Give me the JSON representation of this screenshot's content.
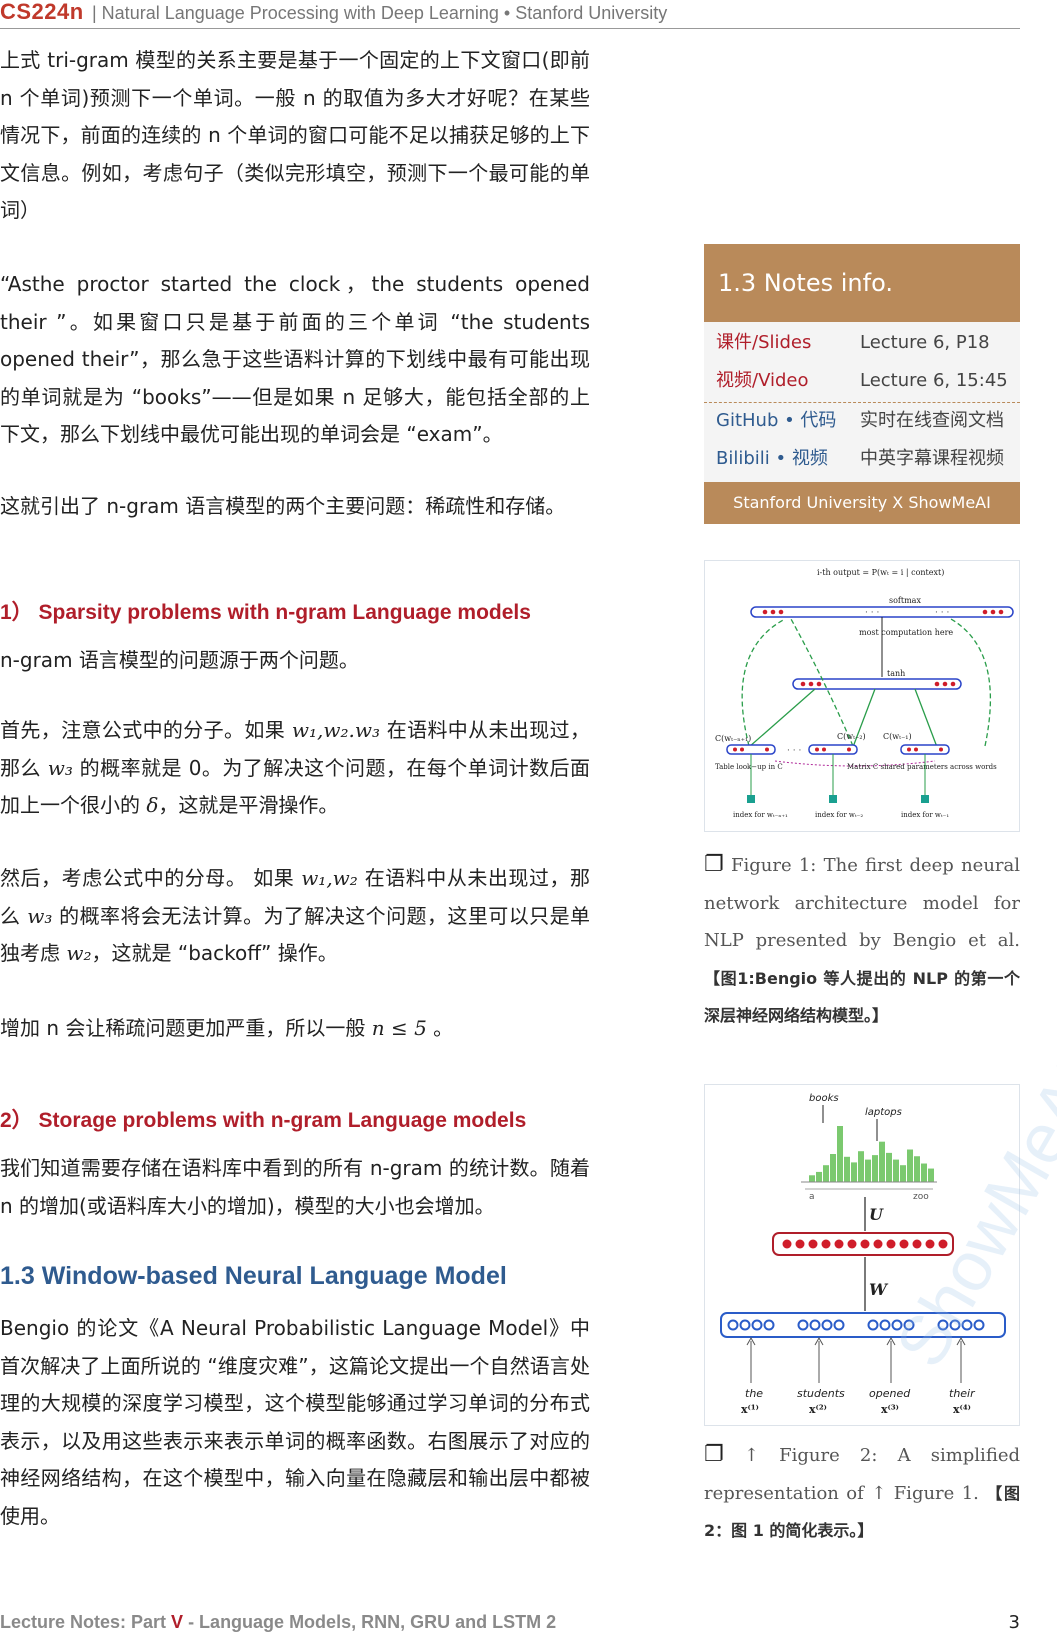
{
  "header": {
    "course_code": "CS224n",
    "course_title": "| Natural Language Processing with Deep Learning • Stanford University"
  },
  "main": {
    "p1": "上式 tri-gram 模型的关系主要是基于一个固定的上下文窗口(即前 n 个单词)预测下一个单词。一般 n 的取值为多大才好呢？在某些情况下，前面的连续的 n 个单词的窗口可能不足以捕获足够的上下文信息。例如，考虑句子（类似完形填空，预测下一个最可能的单词）",
    "p2": "“Asthe proctor started the clock，the students opened their ”。如果窗口只是基于前面的三个单词 “the students opened their”，那么急于这些语料计算的下划线中最有可能出现的单词就是为 “books”——但是如果 n 足够大，能包括全部的上下文，那么下划线中最优可能出现的单词会是 “exam”。",
    "p3": "这就引出了 n-gram 语言模型的两个主要问题：稀疏性和存储。",
    "sec1": "1） Sparsity problems  with n-gram Language models",
    "p4": "n-gram 语言模型的问题源于两个问题。",
    "p5_a": "首先，注意公式中的分子。如果 ",
    "p5_m1": "w₁,w₂.w₃",
    "p5_b": " 在语料中从未出现过，那么 ",
    "p5_m2": "w₃",
    "p5_c": " 的概率就是 0。为了解决这个问题，在每个单词计数后面加上一个很小的 ",
    "p5_m3": "δ",
    "p5_d": "，这就是平滑操作。",
    "p6_a": "然后，考虑公式中的分母。 如果 ",
    "p6_m1": "w₁,w₂",
    "p6_b": " 在语料中从未出现过，那么 ",
    "p6_m2": "w₃",
    "p6_c": " 的概率将会无法计算。为了解决这个问题，这里可以只是单独考虑 ",
    "p6_m3": "w₂",
    "p6_d": "，这就是 “backoff” 操作。",
    "p7_a": "增加 n 会让稀疏问题更加严重，所以一般 ",
    "p7_m": "n ≤ 5",
    "p7_b": " 。",
    "sec2": "2） Storage  problems  with n-gram Language models",
    "p8": "我们知道需要存储在语料库中看到的所有 n-gram 的统计数。随着 n 的增加(或语料库大小的增加)，模型的大小也会增加。",
    "sec3": "1.3 Window-based Neural Language Model",
    "p9": "Bengio 的论文《A Neural Probabilistic Language Model》中首次解决了上面所说的 “维度灾难”，这篇论文提出一个自然语言处理的大规模的深度学习模型，这个模型能够通过学习单词的分布式表示，以及用这些表示来表示单词的概率函数。右图展示了对应的神经网络结构，在这个模型中，输入向量在隐藏层和输出层中都被使用。"
  },
  "info": {
    "title": "1.3 Notes info.",
    "rows": [
      {
        "k": "课件/Slides",
        "v": "Lecture 6, P18"
      },
      {
        "k": "视频/Video",
        "v": "Lecture 6, 15:45"
      },
      {
        "k": "GitHub • 代码",
        "v": "实时在线查阅文档"
      },
      {
        "k": "Bilibili • 视频",
        "v": "中英字幕课程视频"
      }
    ],
    "footer": "Stanford University  X  ShowMeAI"
  },
  "fig1": {
    "output_label": "i-th output = P(wₜ = i | context)",
    "softmax": "softmax",
    "most_computation": "most  computation here",
    "tanh": "tanh",
    "c1": "C(wₜ₋ₙ₊₁)",
    "c2": "C(wₜ₋₂)",
    "c3": "C(wₜ₋₁)",
    "table": "Table look−up in C",
    "matrix": "Matrix C shared parameters across words",
    "idx1": "index for wₜ₋ₙ₊₁",
    "idx2": "index for wₜ₋₂",
    "idx3": "index for wₜ₋₁",
    "caption_a": " Figure 1: The first deep neural network architecture model for NLP presented by Bengio et al. ",
    "caption_b": "【图1:Bengio 等人提出的 NLP 的第一个深层神经网络结构模型。】"
  },
  "fig2": {
    "books": "books",
    "laptops": "laptops",
    "a": "a",
    "zoo": "zoo",
    "U": "U",
    "W": "W",
    "words": [
      "the",
      "students",
      "opened",
      "their"
    ],
    "xs": [
      "x⁽¹⁾",
      "x⁽²⁾",
      "x⁽³⁾",
      "x⁽⁴⁾"
    ],
    "hist": [
      0.12,
      0.18,
      0.3,
      0.5,
      1.0,
      0.45,
      0.35,
      0.55,
      0.4,
      0.48,
      0.72,
      0.52,
      0.4,
      0.3,
      0.58,
      0.46,
      0.33,
      0.24
    ],
    "caption_a": " ↑ Figure 2: A simplified representation of ↑ Figure 1. ",
    "caption_b": "【图2：图 1 的简化表示。】"
  },
  "footer": {
    "left_a": "Lecture Notes: Part ",
    "part": "V",
    "left_b": " - Language Models, RNN, GRU and LSTM 2",
    "page": "3"
  },
  "watermark": "ShowMeAI"
}
